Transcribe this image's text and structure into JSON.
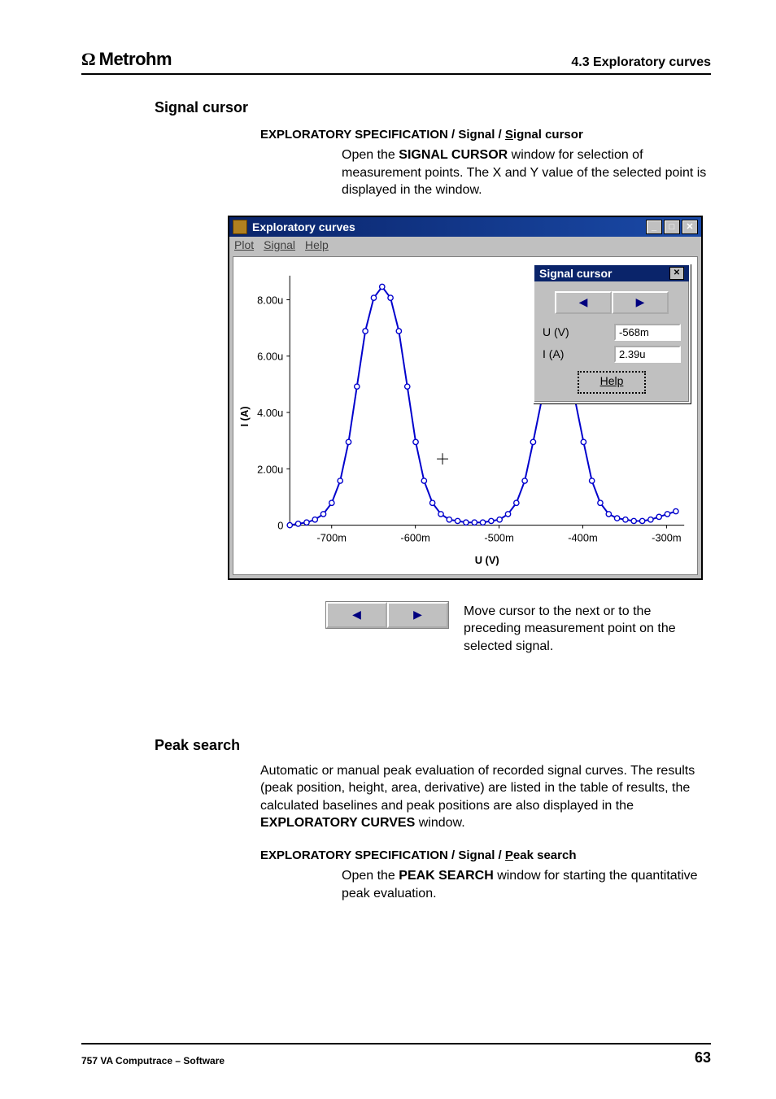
{
  "header": {
    "logo_text": "Metrohm",
    "chapter": "4.3  Exploratory curves"
  },
  "section1": {
    "heading": "Signal cursor",
    "breadcrumb_prefix": "EXPLORATORY SPECIFICATION / Si",
    "breadcrumb_g": "g",
    "breadcrumb_mid": "nal / ",
    "breadcrumb_s": "S",
    "breadcrumb_end": "ignal cursor",
    "body_prefix": "Open the ",
    "body_sc": "SIGNAL CURSOR",
    "body_rest": " window for selection of measurement points. The X and Y value of the selected point is displayed in the window."
  },
  "app": {
    "title": "Exploratory curves",
    "menu": {
      "plot": "Plot",
      "signal": "Signal",
      "help": "Help"
    },
    "y_ticks": [
      "8.00u",
      "6.00u",
      "4.00u",
      "2.00u",
      "0"
    ],
    "x_ticks": [
      "-700m",
      "-600m",
      "-500m",
      "-400m",
      "-300m"
    ],
    "y_label": "I (A)",
    "x_label": "U (V)",
    "cursor_win": {
      "title": "Signal cursor",
      "u_label": "U (V)",
      "u_value": "-568m",
      "i_label": "I (A)",
      "i_value": "2.39u",
      "help": "Help"
    }
  },
  "arrows_caption": "Move cursor to the next or to the preceding measurement point on the selected signal.",
  "section2": {
    "heading": "Peak search",
    "body_wide_pre": "Automatic or manual peak evaluation of recorded signal curves. The results (peak position, height, area, derivative) are listed in the table of results, the calculated baselines and peak positions are also displayed in the ",
    "body_wide_sc": "EXPLORATORY CURVES",
    "body_wide_post": " window.",
    "breadcrumb_prefix": "EXPLORATORY SPECIFICATION / Si",
    "breadcrumb_g": "g",
    "breadcrumb_mid": "nal / ",
    "breadcrumb_p": "P",
    "breadcrumb_end": "eak search",
    "body2_prefix": "Open the ",
    "body2_sc": "PEAK SEARCH",
    "body2_rest": " window for starting the quantitative peak evaluation."
  },
  "footer": {
    "left": "757 VA Computrace – Software",
    "page": "63"
  },
  "chart_data": {
    "type": "line",
    "title": "Exploratory curves",
    "xlabel": "U (V)",
    "ylabel": "I (A)",
    "xlim": [
      -0.75,
      -0.28
    ],
    "ylim": [
      0,
      9e-06
    ],
    "x_ticks": [
      -0.7,
      -0.6,
      -0.5,
      -0.4,
      -0.3
    ],
    "y_ticks": [
      0,
      2e-06,
      4e-06,
      6e-06,
      8e-06
    ],
    "series": [
      {
        "name": "signal",
        "x": [
          -0.75,
          -0.74,
          -0.73,
          -0.72,
          -0.71,
          -0.7,
          -0.69,
          -0.68,
          -0.67,
          -0.66,
          -0.65,
          -0.64,
          -0.63,
          -0.62,
          -0.61,
          -0.6,
          -0.59,
          -0.58,
          -0.57,
          -0.56,
          -0.55,
          -0.54,
          -0.53,
          -0.52,
          -0.51,
          -0.5,
          -0.49,
          -0.48,
          -0.47,
          -0.46,
          -0.45,
          -0.44,
          -0.43,
          -0.42,
          -0.41,
          -0.4,
          -0.39,
          -0.38,
          -0.37,
          -0.36,
          -0.35,
          -0.34,
          -0.33,
          -0.32,
          -0.31,
          -0.3,
          -0.29
        ],
        "y": [
          0.0,
          5e-08,
          1e-07,
          2e-07,
          4e-07,
          8e-07,
          1.6e-06,
          3e-06,
          5e-06,
          7e-06,
          8.2e-06,
          8.6e-06,
          8.2e-06,
          7e-06,
          5e-06,
          3e-06,
          1.6e-06,
          8e-07,
          4e-07,
          2e-07,
          1.5e-07,
          1e-07,
          1e-07,
          1e-07,
          1.5e-07,
          2e-07,
          4e-07,
          8e-07,
          1.6e-06,
          3e-06,
          4.5e-06,
          5.4e-06,
          5.7e-06,
          5.4e-06,
          4.5e-06,
          3e-06,
          1.6e-06,
          8e-07,
          4e-07,
          2.5e-07,
          2e-07,
          1.5e-07,
          1.5e-07,
          2e-07,
          3e-07,
          4e-07,
          5e-07
        ]
      }
    ],
    "cursor": {
      "x": -0.568,
      "y": 2.39e-06
    }
  }
}
